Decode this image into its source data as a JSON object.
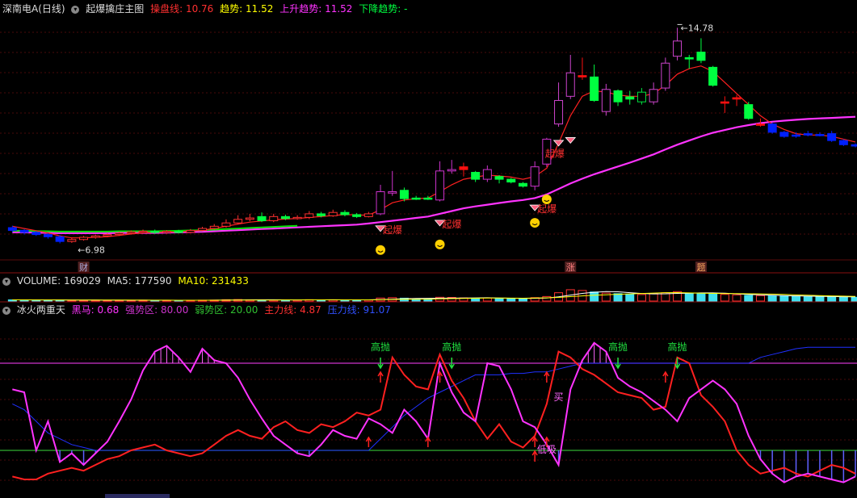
{
  "header": {
    "stock_name": "深南电A(日线)",
    "main_indicator": "起爆擒庄主图",
    "line1_label": "操盘线:",
    "line1_value": "10.76",
    "line2_label": "趋势:",
    "line2_value": "11.52",
    "line3_label": "上升趋势:",
    "line3_value": "11.52",
    "line4_label": "下降趋势:",
    "line4_value": "-"
  },
  "volume_header": {
    "label": "VOLUME:",
    "value": "169029",
    "ma5_label": "MA5:",
    "ma5_value": "177590",
    "ma10_label": "MA10:",
    "ma10_value": "231433"
  },
  "indicator_header": {
    "name": "冰火两重天",
    "i1_label": "黑马:",
    "i1_value": "0.68",
    "i2_label": "强势区:",
    "i2_value": "80.00",
    "i3_label": "弱势区:",
    "i3_value": "20.00",
    "i4_label": "主力线:",
    "i4_value": "4.87",
    "i5_label": "压力线:",
    "i5_value": "91.07"
  },
  "markers": {
    "high_price": "14.78",
    "low_price": "6.98",
    "qibao": "起爆",
    "gaopao": "高抛",
    "mai": "买",
    "dixi": "低吸",
    "badge_cai": "财",
    "badge_zhang": "涨",
    "badge_ti": "题"
  },
  "colors": {
    "up": "#ff3030",
    "down": "#00ff40",
    "bluedown": "#0020ff",
    "ma": "#ff2020",
    "trend": "#ff33ff",
    "green_trend": "#00e000",
    "rsi": "#ff33ff",
    "main_line": "#ff2020",
    "pressure": "#2030ff",
    "strong": "#cc33cc",
    "weak": "#30b030"
  },
  "chart_data": [
    {
      "type": "candlestick",
      "price_range": [
        6.5,
        15.2
      ],
      "candles": [
        {
          "o": 7.55,
          "c": 7.45,
          "h": 7.62,
          "l": 7.38,
          "col": "b"
        },
        {
          "o": 7.45,
          "c": 7.38,
          "h": 7.5,
          "l": 7.3,
          "col": "b"
        },
        {
          "o": 7.38,
          "c": 7.3,
          "h": 7.42,
          "l": 7.25,
          "col": "b"
        },
        {
          "o": 7.3,
          "c": 7.22,
          "h": 7.35,
          "l": 7.15,
          "col": "b"
        },
        {
          "o": 7.22,
          "c": 7.05,
          "h": 7.28,
          "l": 6.98,
          "col": "b"
        },
        {
          "o": 7.05,
          "c": 7.12,
          "h": 7.18,
          "l": 7.0,
          "col": "u"
        },
        {
          "o": 7.12,
          "c": 7.2,
          "h": 7.25,
          "l": 7.08,
          "col": "u"
        },
        {
          "o": 7.2,
          "c": 7.25,
          "h": 7.3,
          "l": 7.15,
          "col": "u"
        },
        {
          "o": 7.25,
          "c": 7.3,
          "h": 7.35,
          "l": 7.2,
          "col": "u"
        },
        {
          "o": 7.3,
          "c": 7.35,
          "h": 7.4,
          "l": 7.25,
          "col": "u"
        },
        {
          "o": 7.35,
          "c": 7.4,
          "h": 7.45,
          "l": 7.3,
          "col": "u"
        },
        {
          "o": 7.4,
          "c": 7.42,
          "h": 7.48,
          "l": 7.35,
          "col": "u"
        },
        {
          "o": 7.42,
          "c": 7.38,
          "h": 7.48,
          "l": 7.32,
          "col": "g"
        },
        {
          "o": 7.38,
          "c": 7.42,
          "h": 7.46,
          "l": 7.33,
          "col": "u"
        },
        {
          "o": 7.42,
          "c": 7.38,
          "h": 7.47,
          "l": 7.34,
          "col": "g"
        },
        {
          "o": 7.38,
          "c": 7.45,
          "h": 7.5,
          "l": 7.35,
          "col": "u"
        },
        {
          "o": 7.45,
          "c": 7.52,
          "h": 7.58,
          "l": 7.42,
          "col": "u"
        },
        {
          "o": 7.52,
          "c": 7.6,
          "h": 7.68,
          "l": 7.48,
          "col": "u"
        },
        {
          "o": 7.6,
          "c": 7.72,
          "h": 7.85,
          "l": 7.55,
          "col": "u"
        },
        {
          "o": 7.72,
          "c": 7.85,
          "h": 8.0,
          "l": 7.68,
          "col": "u"
        },
        {
          "o": 7.85,
          "c": 7.9,
          "h": 8.05,
          "l": 7.78,
          "col": "u"
        },
        {
          "o": 7.95,
          "c": 7.8,
          "h": 8.1,
          "l": 7.75,
          "col": "g"
        },
        {
          "o": 7.8,
          "c": 7.95,
          "h": 8.05,
          "l": 7.75,
          "col": "u"
        },
        {
          "o": 7.95,
          "c": 7.88,
          "h": 8.02,
          "l": 7.82,
          "col": "g"
        },
        {
          "o": 7.88,
          "c": 7.92,
          "h": 8.0,
          "l": 7.84,
          "col": "u"
        },
        {
          "o": 7.92,
          "c": 8.05,
          "h": 8.15,
          "l": 7.86,
          "col": "u"
        },
        {
          "o": 8.05,
          "c": 7.98,
          "h": 8.12,
          "l": 7.92,
          "col": "g"
        },
        {
          "o": 7.98,
          "c": 8.1,
          "h": 8.2,
          "l": 7.94,
          "col": "u"
        },
        {
          "o": 8.1,
          "c": 8.02,
          "h": 8.18,
          "l": 7.96,
          "col": "g"
        },
        {
          "o": 8.02,
          "c": 7.95,
          "h": 8.08,
          "l": 7.9,
          "col": "g"
        },
        {
          "o": 7.95,
          "c": 8.05,
          "h": 8.12,
          "l": 7.92,
          "col": "u"
        },
        {
          "o": 8.05,
          "c": 8.85,
          "h": 9.1,
          "l": 8.0,
          "col": "u"
        },
        {
          "o": 8.85,
          "c": 8.8,
          "h": 9.6,
          "l": 8.7,
          "col": "u"
        },
        {
          "o": 8.9,
          "c": 8.6,
          "h": 9.0,
          "l": 8.5,
          "col": "g"
        },
        {
          "o": 8.6,
          "c": 8.62,
          "h": 8.7,
          "l": 8.55,
          "col": "g"
        },
        {
          "o": 8.62,
          "c": 8.6,
          "h": 8.7,
          "l": 8.55,
          "col": "g"
        },
        {
          "o": 8.55,
          "c": 9.6,
          "h": 9.95,
          "l": 8.5,
          "col": "u"
        },
        {
          "o": 9.6,
          "c": 9.65,
          "h": 10.0,
          "l": 9.5,
          "col": "u"
        },
        {
          "o": 9.75,
          "c": 9.65,
          "h": 9.9,
          "l": 9.4,
          "col": "r"
        },
        {
          "o": 9.55,
          "c": 9.3,
          "h": 9.6,
          "l": 9.2,
          "col": "g"
        },
        {
          "o": 9.3,
          "c": 9.65,
          "h": 9.8,
          "l": 9.2,
          "col": "u"
        },
        {
          "o": 9.4,
          "c": 9.3,
          "h": 9.45,
          "l": 9.15,
          "col": "g"
        },
        {
          "o": 9.3,
          "c": 9.2,
          "h": 9.35,
          "l": 9.15,
          "col": "g"
        },
        {
          "o": 9.05,
          "c": 9.15,
          "h": 9.2,
          "l": 9.0,
          "col": "g"
        },
        {
          "o": 9.05,
          "c": 9.75,
          "h": 9.95,
          "l": 8.9,
          "col": "u"
        },
        {
          "o": 9.85,
          "c": 10.75,
          "h": 10.8,
          "l": 9.75,
          "col": "u"
        },
        {
          "o": 11.3,
          "c": 12.15,
          "h": 12.8,
          "l": 11.2,
          "col": "u"
        },
        {
          "o": 12.3,
          "c": 13.15,
          "h": 13.8,
          "l": 12.2,
          "col": "u"
        },
        {
          "o": 13.0,
          "c": 13.05,
          "h": 13.7,
          "l": 12.9,
          "col": "r"
        },
        {
          "o": 13.0,
          "c": 12.15,
          "h": 13.45,
          "l": 12.1,
          "col": "g"
        },
        {
          "o": 11.75,
          "c": 12.55,
          "h": 12.75,
          "l": 11.6,
          "col": "u"
        },
        {
          "o": 12.5,
          "c": 12.1,
          "h": 12.55,
          "l": 11.95,
          "col": "g"
        },
        {
          "o": 12.2,
          "c": 12.28,
          "h": 12.5,
          "l": 12.0,
          "col": "g"
        },
        {
          "o": 12.45,
          "c": 12.1,
          "h": 12.6,
          "l": 12.0,
          "col": "u"
        },
        {
          "o": 12.1,
          "c": 12.55,
          "h": 12.8,
          "l": 12.0,
          "col": "u"
        },
        {
          "o": 12.6,
          "c": 13.5,
          "h": 13.7,
          "l": 12.5,
          "col": "u"
        },
        {
          "o": 13.75,
          "c": 14.3,
          "h": 14.78,
          "l": 13.6,
          "col": "u"
        },
        {
          "o": 13.65,
          "c": 13.7,
          "h": 13.8,
          "l": 13.3,
          "col": "g"
        },
        {
          "o": 13.6,
          "c": 13.9,
          "h": 14.4,
          "l": 13.5,
          "col": "g"
        },
        {
          "o": 13.35,
          "c": 12.7,
          "h": 13.4,
          "l": 12.65,
          "col": "g"
        },
        {
          "o": 12.05,
          "c": 12.1,
          "h": 12.3,
          "l": 11.7,
          "col": "r"
        },
        {
          "o": 12.25,
          "c": 12.2,
          "h": 12.35,
          "l": 11.95,
          "col": "r"
        },
        {
          "o": 12.0,
          "c": 11.5,
          "h": 12.1,
          "l": 11.45,
          "col": "g"
        },
        {
          "o": 11.25,
          "c": 11.3,
          "h": 11.5,
          "l": 11.2,
          "col": "r"
        },
        {
          "o": 11.3,
          "c": 11.0,
          "h": 11.35,
          "l": 10.95,
          "col": "b"
        },
        {
          "o": 11.0,
          "c": 10.85,
          "h": 11.05,
          "l": 10.8,
          "col": "b"
        },
        {
          "o": 10.9,
          "c": 10.88,
          "h": 11.0,
          "l": 10.8,
          "col": "b"
        },
        {
          "o": 10.95,
          "c": 10.9,
          "h": 11.05,
          "l": 10.85,
          "col": "b"
        },
        {
          "o": 10.9,
          "c": 10.92,
          "h": 11.0,
          "l": 10.85,
          "col": "b"
        },
        {
          "o": 10.95,
          "c": 10.7,
          "h": 11.05,
          "l": 10.65,
          "col": "b"
        },
        {
          "o": 10.7,
          "c": 10.55,
          "h": 10.75,
          "l": 10.5,
          "col": "b"
        },
        {
          "o": 10.55,
          "c": 10.5,
          "h": 10.6,
          "l": 10.45,
          "col": "b"
        }
      ],
      "ma_line": [
        7.6,
        7.52,
        7.44,
        7.36,
        7.25,
        7.18,
        7.18,
        7.2,
        7.22,
        7.27,
        7.32,
        7.36,
        7.38,
        7.39,
        7.4,
        7.42,
        7.46,
        7.52,
        7.6,
        7.68,
        7.75,
        7.79,
        7.83,
        7.86,
        7.88,
        7.92,
        7.95,
        7.99,
        8.02,
        8.01,
        8.0,
        8.2,
        8.45,
        8.55,
        8.6,
        8.62,
        8.85,
        9.1,
        9.3,
        9.38,
        9.45,
        9.42,
        9.38,
        9.3,
        9.4,
        9.7,
        10.6,
        11.6,
        12.3,
        12.5,
        12.45,
        12.35,
        12.3,
        12.3,
        12.4,
        12.7,
        13.1,
        13.3,
        13.4,
        13.2,
        12.8,
        12.4,
        12.0,
        11.6,
        11.3,
        11.1,
        10.95,
        10.9,
        10.9,
        10.85,
        10.75,
        10.65
      ],
      "trend_line": [
        7.38,
        7.38,
        7.37,
        7.36,
        7.35,
        7.35,
        7.35,
        7.35,
        7.35,
        7.36,
        7.36,
        7.36,
        7.36,
        7.37,
        7.38,
        7.39,
        7.4,
        7.42,
        7.44,
        7.46,
        7.48,
        7.5,
        7.52,
        7.54,
        7.56,
        7.58,
        7.6,
        7.62,
        7.64,
        7.66,
        7.7,
        7.75,
        7.8,
        7.85,
        7.9,
        7.95,
        8.05,
        8.15,
        8.25,
        8.32,
        8.38,
        8.44,
        8.5,
        8.55,
        8.62,
        8.75,
        8.95,
        9.15,
        9.32,
        9.48,
        9.62,
        9.76,
        9.9,
        10.05,
        10.2,
        10.38,
        10.55,
        10.7,
        10.85,
        10.98,
        11.08,
        11.18,
        11.26,
        11.33,
        11.38,
        11.42,
        11.45,
        11.48,
        11.5,
        11.52,
        11.54,
        11.56
      ],
      "green_trend_len": 25
    },
    {
      "type": "bar",
      "name": "VOLUME",
      "values": [
        16,
        15,
        14,
        13,
        15,
        12,
        11,
        12,
        11,
        10,
        11,
        12,
        10,
        11,
        10,
        11,
        12,
        13,
        18,
        20,
        17,
        15,
        16,
        14,
        15,
        18,
        16,
        17,
        15,
        14,
        16,
        40,
        45,
        38,
        30,
        28,
        50,
        48,
        42,
        38,
        41,
        35,
        33,
        30,
        45,
        60,
        110,
        150,
        140,
        120,
        105,
        98,
        92,
        86,
        95,
        110,
        125,
        105,
        102,
        95,
        88,
        82,
        75,
        72,
        68,
        65,
        62,
        60,
        58,
        55,
        52,
        50
      ],
      "colors": [
        "c",
        "c",
        "c",
        "c",
        "c",
        "r",
        "r",
        "r",
        "r",
        "r",
        "r",
        "r",
        "c",
        "r",
        "c",
        "r",
        "r",
        "r",
        "r",
        "r",
        "r",
        "c",
        "r",
        "c",
        "r",
        "r",
        "c",
        "r",
        "c",
        "c",
        "r",
        "r",
        "r",
        "c",
        "c",
        "c",
        "r",
        "r",
        "r",
        "c",
        "r",
        "c",
        "c",
        "c",
        "r",
        "r",
        "r",
        "r",
        "r",
        "c",
        "r",
        "c",
        "c",
        "r",
        "r",
        "r",
        "r",
        "c",
        "c",
        "c",
        "r",
        "r",
        "c",
        "r",
        "c",
        "c",
        "c",
        "c",
        "c",
        "c",
        "c",
        "c"
      ],
      "ylim": [
        0,
        160
      ]
    },
    {
      "type": "line",
      "name": "冰火两重天",
      "ylim": [
        -10,
        110
      ],
      "rsi": [
        62,
        60,
        20,
        40,
        12,
        18,
        10,
        18,
        26,
        40,
        55,
        75,
        88,
        92,
        84,
        74,
        90,
        82,
        80,
        70,
        55,
        42,
        30,
        24,
        18,
        16,
        24,
        34,
        30,
        28,
        42,
        38,
        32,
        48,
        40,
        28,
        80,
        60,
        46,
        40,
        80,
        78,
        62,
        40,
        36,
        24,
        10,
        62,
        82,
        94,
        88,
        70,
        64,
        60,
        54,
        48,
        40,
        56,
        62,
        68,
        62,
        52,
        30,
        14,
        4,
        -2,
        2,
        4,
        2,
        0,
        -2,
        2
      ],
      "main": [
        2,
        0,
        0,
        4,
        6,
        8,
        6,
        10,
        14,
        16,
        20,
        22,
        24,
        20,
        18,
        16,
        18,
        24,
        30,
        34,
        30,
        28,
        36,
        40,
        34,
        32,
        38,
        36,
        40,
        46,
        44,
        48,
        84,
        72,
        64,
        62,
        86,
        68,
        56,
        40,
        28,
        38,
        26,
        22,
        30,
        52,
        88,
        84,
        76,
        72,
        66,
        60,
        58,
        56,
        48,
        50,
        84,
        80,
        58,
        50,
        40,
        20,
        10,
        4,
        6,
        8,
        4,
        2,
        6,
        10,
        8,
        4
      ],
      "pressure": [
        52,
        48,
        40,
        32,
        28,
        24,
        22,
        20,
        20,
        20,
        20,
        20,
        20,
        20,
        20,
        20,
        20,
        20,
        20,
        20,
        20,
        20,
        20,
        20,
        20,
        20,
        20,
        20,
        20,
        20,
        20,
        28,
        36,
        44,
        50,
        56,
        60,
        64,
        68,
        72,
        72,
        72,
        73,
        73,
        74,
        74,
        76,
        78,
        80,
        80,
        80,
        80,
        80,
        80,
        80,
        80,
        80,
        80,
        80,
        80,
        80,
        80,
        80,
        84,
        86,
        88,
        90,
        91,
        91,
        91,
        91,
        91
      ],
      "strong": 80,
      "weak": 20,
      "gaopao_idx": [
        31,
        37,
        51,
        56
      ],
      "up_arrow_idx": [
        31,
        36,
        45,
        55
      ],
      "low_up_idx": [
        30,
        35,
        44,
        45
      ]
    }
  ]
}
